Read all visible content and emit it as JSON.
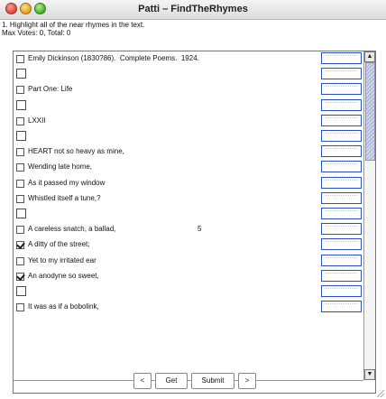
{
  "window": {
    "title": "Patti – FindTheRhymes"
  },
  "instruction": "1. Highlight all of the near rhymes in the text.",
  "votes": "Max Votes: 0, Total: 0",
  "lines": [
    {
      "text": "Emily Dickinson (1830?86).  Complete Poems.  1924.",
      "checked": false,
      "empty": false
    },
    {
      "text": "",
      "checked": false,
      "empty": true
    },
    {
      "text": "Part One: Life",
      "checked": false,
      "empty": false
    },
    {
      "text": "",
      "checked": false,
      "empty": true
    },
    {
      "text": "LXXII",
      "checked": false,
      "empty": false
    },
    {
      "text": "",
      "checked": false,
      "empty": true
    },
    {
      "text": "HEART not so heavy as mine,",
      "checked": false,
      "empty": false
    },
    {
      "text": "Wending late home,",
      "checked": false,
      "empty": false
    },
    {
      "text": "As it passed my window",
      "checked": false,
      "empty": false
    },
    {
      "text": "Whistled itself a tune,?",
      "checked": false,
      "empty": false
    },
    {
      "text": "",
      "checked": false,
      "empty": true
    },
    {
      "text": "A careless snatch, a ballad,",
      "number": "5",
      "checked": false,
      "empty": false
    },
    {
      "text": "A ditty of the street;",
      "checked": true,
      "empty": false
    },
    {
      "text": "Yet to my irritated ear",
      "checked": false,
      "empty": false
    },
    {
      "text": "An anodyne so sweet,",
      "checked": true,
      "empty": false
    },
    {
      "text": "",
      "checked": false,
      "empty": true
    },
    {
      "text": "It was as if a bobolink,",
      "checked": false,
      "empty": false
    }
  ],
  "scroll_thumb_fraction": 0.32,
  "buttons": {
    "prev": "<",
    "get": "Get",
    "submit": "Submit",
    "next": ">"
  },
  "icons": {
    "close": "close-icon",
    "minimize": "minimize-icon",
    "maximize": "maximize-icon",
    "scroll_up": "chevron-up-icon",
    "scroll_down": "chevron-down-icon",
    "resize": "resize-grip-icon"
  },
  "colors": {
    "field_border": "#2a50c8",
    "scroll_thumb": "#a6acd6"
  }
}
